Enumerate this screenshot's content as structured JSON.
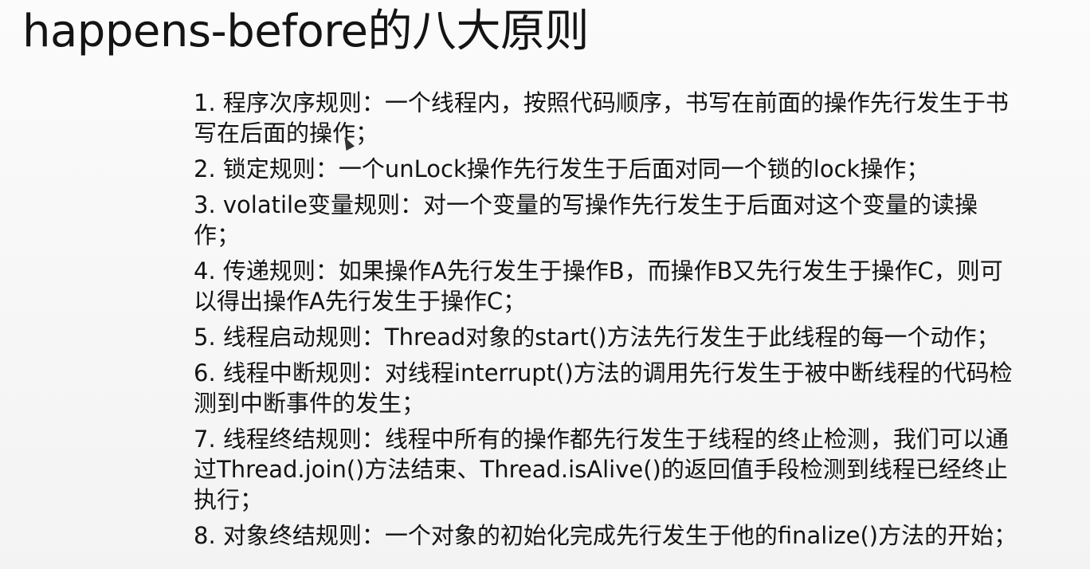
{
  "slide": {
    "title": "happens-before的八大原则",
    "rules": [
      {
        "lines": [
          "1. 程序次序规则：一个线程内，按照代码顺序，书写在前面的操作先行发生于书",
          "写在后面的操作；"
        ]
      },
      {
        "lines": [
          "2. 锁定规则：一个unLock操作先行发生于后面对同一个锁的lock操作；"
        ]
      },
      {
        "lines": [
          "3. volatile变量规则：对一个变量的写操作先行发生于后面对这个变量的读操",
          "作；"
        ]
      },
      {
        "lines": [
          "4. 传递规则：如果操作A先行发生于操作B，而操作B又先行发生于操作C，则可",
          "以得出操作A先行发生于操作C；"
        ]
      },
      {
        "lines": [
          "5. 线程启动规则：Thread对象的start()方法先行发生于此线程的每一个动作；"
        ]
      },
      {
        "lines": [
          "6. 线程中断规则：对线程interrupt()方法的调用先行发生于被中断线程的代码检",
          "测到中断事件的发生；"
        ]
      },
      {
        "lines": [
          "7. 线程终结规则：线程中所有的操作都先行发生于线程的终止检测，我们可以通",
          "过Thread.join()方法结束、Thread.isAlive()的返回值手段检测到线程已经终止",
          "执行；"
        ]
      },
      {
        "lines": [
          "8. 对象终结规则：一个对象的初始化完成先行发生于他的finalize()方法的开始；"
        ]
      }
    ]
  }
}
